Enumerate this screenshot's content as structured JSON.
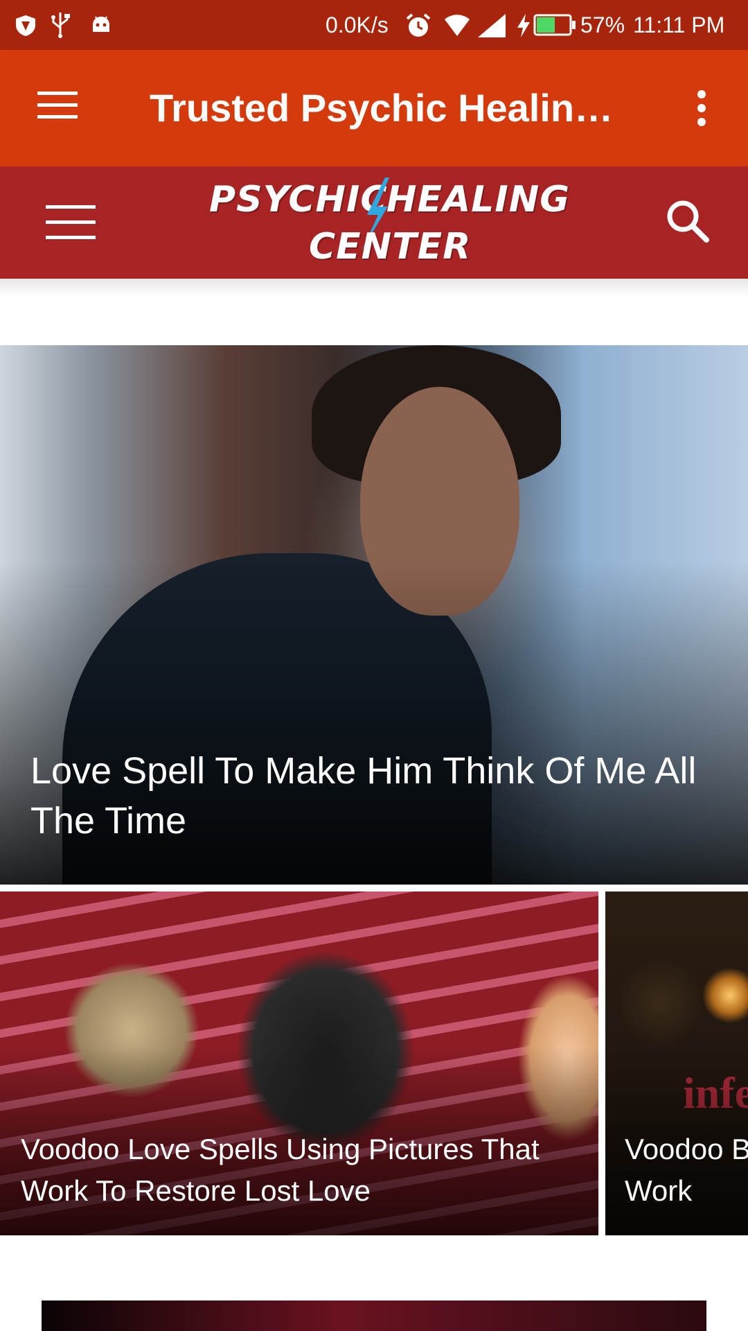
{
  "status_bar": {
    "net_speed": "0.0K/s",
    "battery_percent": "57%",
    "time": "11:11 PM",
    "battery_level": 0.57,
    "icons": [
      "shield-icon",
      "usb-icon",
      "android-icon",
      "alarm-icon",
      "wifi-icon",
      "signal-icon",
      "charging-icon",
      "battery-icon"
    ]
  },
  "app_bar": {
    "title": "Trusted Psychic Healing…",
    "icons": [
      "menu-icon",
      "more-vert-icon"
    ]
  },
  "site_header": {
    "logo_line1": "PSYCHIC",
    "logo_line1b": "HEALING",
    "logo_line2": "CENTER",
    "icons": [
      "menu-icon",
      "search-icon"
    ],
    "bolt_color": "#2fa8e0"
  },
  "hero": {
    "title": "Love Spell To Make Him Think Of Me All The Time"
  },
  "cards": [
    {
      "title": "Voodoo Love Spells Using Pictures That Work To Restore Lost Love"
    },
    {
      "title": "Voodoo B",
      "title_line2": "Work",
      "overlay_text": "infe"
    }
  ],
  "colors": {
    "status_bar": "#a8250b",
    "app_bar": "#d43a0b",
    "site_header": "#a72324"
  }
}
